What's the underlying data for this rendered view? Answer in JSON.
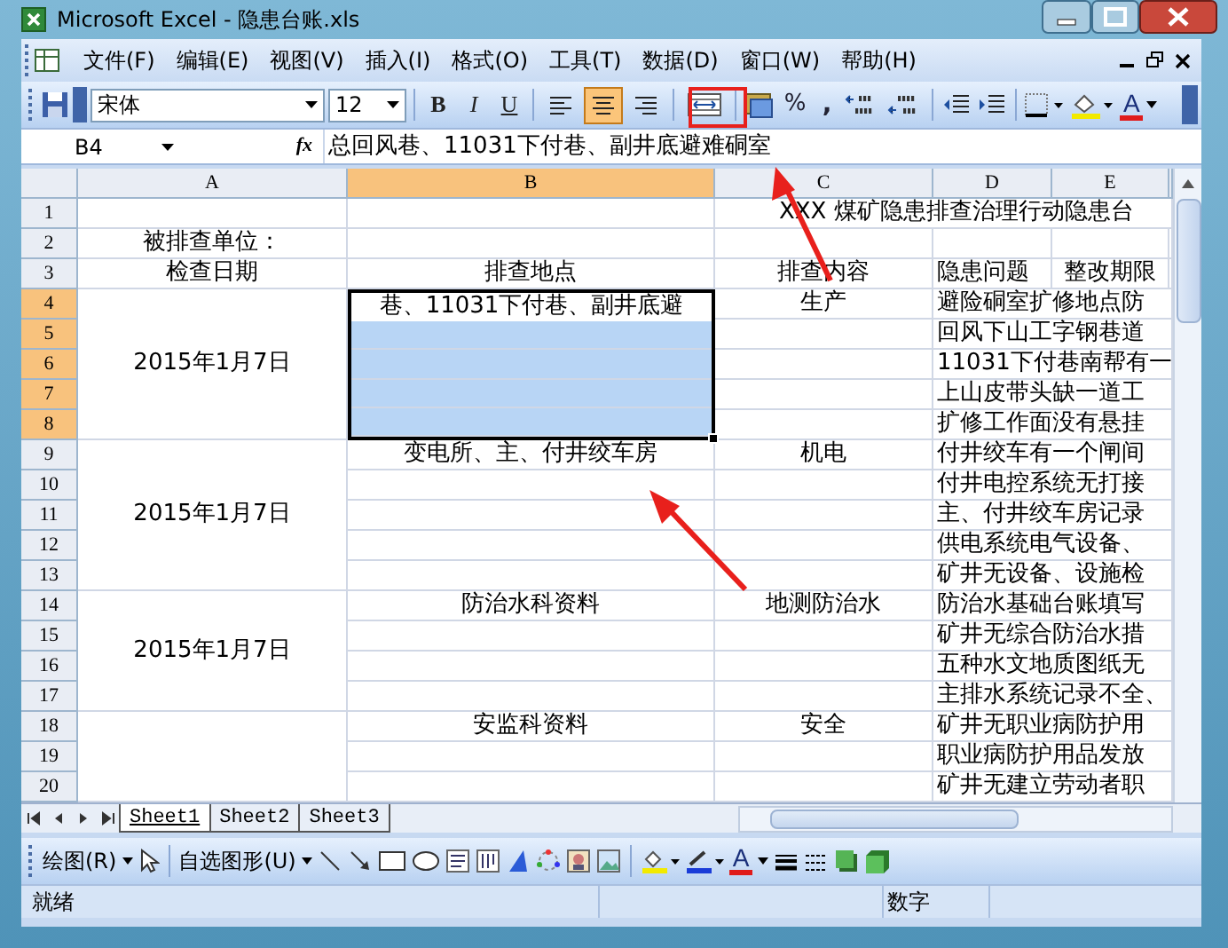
{
  "window": {
    "title": "Microsoft Excel - 隐患台账.xls"
  },
  "menu_bar": {
    "items": [
      "文件(F)",
      "编辑(E)",
      "视图(V)",
      "插入(I)",
      "格式(O)",
      "工具(T)",
      "数据(D)",
      "窗口(W)",
      "帮助(H)"
    ]
  },
  "formatting_toolbar": {
    "font": "宋体",
    "font_size": "12",
    "style_buttons": [
      "B",
      "I",
      "U"
    ],
    "alignment": [
      {
        "selected": false
      },
      {
        "selected": true
      },
      {
        "selected": false
      }
    ],
    "percent": "%",
    "comma": ",",
    "font_color_label": "A"
  },
  "formula_bar": {
    "name_box": "B4",
    "function_label": "fx",
    "value": "总回风巷、11031下付巷、副井底避难硐室"
  },
  "sheet": {
    "columns": [
      {
        "label": "A",
        "selected": false
      },
      {
        "label": "B",
        "selected": true
      },
      {
        "label": "C",
        "selected": false
      },
      {
        "label": "D",
        "selected": false
      },
      {
        "label": "E",
        "selected": false
      }
    ],
    "rows": [
      {
        "label": "1",
        "selected": false,
        "cells": {
          "C": "XXX 煤矿隐患排查治理行动隐患台"
        }
      },
      {
        "label": "2",
        "selected": false,
        "cells": {
          "A": "被排查单位："
        }
      },
      {
        "label": "3",
        "selected": false,
        "cells": {
          "A": "检查日期",
          "B": "排查地点",
          "C": "排查内容",
          "D": "隐患问题",
          "E": "整改期限"
        }
      },
      {
        "label": "4",
        "selected": true,
        "cells": {
          "A": "2015年1月7日",
          "B": "巷、11031下付巷、副井底避",
          "C": "生产",
          "D": "避险硐室扩修地点防"
        }
      },
      {
        "label": "5",
        "selected": true,
        "merge_A_with_above": true,
        "cells": {
          "D": "回风下山工字钢巷道"
        }
      },
      {
        "label": "6",
        "selected": true,
        "merge_A_with_above": true,
        "cells": {
          "D": "11031下付巷南帮有一"
        }
      },
      {
        "label": "7",
        "selected": true,
        "merge_A_with_above": true,
        "cells": {
          "D": "上山皮带头缺一道工"
        }
      },
      {
        "label": "8",
        "selected": true,
        "merge_A_with_above": true,
        "cells": {
          "D": "扩修工作面没有悬挂"
        }
      },
      {
        "label": "9",
        "selected": false,
        "cells": {
          "A": "2015年1月7日",
          "B": "变电所、主、付井绞车房",
          "C": "机电",
          "D": "付井绞车有一个闸间"
        }
      },
      {
        "label": "10",
        "selected": false,
        "merge_A_with_above": true,
        "cells": {
          "D": "付井电控系统无打接"
        }
      },
      {
        "label": "11",
        "selected": false,
        "merge_A_with_above": true,
        "cells": {
          "D": "主、付井绞车房记录"
        }
      },
      {
        "label": "12",
        "selected": false,
        "merge_A_with_above": true,
        "cells": {
          "D": "供电系统电气设备、"
        }
      },
      {
        "label": "13",
        "selected": false,
        "merge_A_with_above": true,
        "cells": {
          "D": "矿井无设备、设施检"
        }
      },
      {
        "label": "14",
        "selected": false,
        "cells": {
          "A": "2015年1月7日",
          "B": "防治水科资料",
          "C": "地测防治水",
          "D": "防治水基础台账填写"
        }
      },
      {
        "label": "15",
        "selected": false,
        "merge_A_with_above": true,
        "cells": {
          "D": "矿井无综合防治水措"
        }
      },
      {
        "label": "16",
        "selected": false,
        "merge_A_with_above": true,
        "cells": {
          "D": "五种水文地质图纸无"
        }
      },
      {
        "label": "17",
        "selected": false,
        "merge_A_with_above": true,
        "cells": {
          "D": "主排水系统记录不全、"
        }
      },
      {
        "label": "18",
        "selected": false,
        "cells": {
          "B": "安监科资料",
          "C": "安全",
          "D": "矿井无职业病防护用"
        }
      },
      {
        "label": "19",
        "selected": false,
        "merge_A_with_above": true,
        "cells": {
          "D": "职业病防护用品发放"
        }
      },
      {
        "label": "20",
        "selected": false,
        "merge_A_with_above": true,
        "cells": {
          "D": "矿井无建立劳动者职"
        }
      }
    ]
  },
  "sheet_tabs": [
    {
      "label": "Sheet1",
      "selected": true
    },
    {
      "label": "Sheet2",
      "selected": false
    },
    {
      "label": "Sheet3",
      "selected": false
    }
  ],
  "drawing_toolbar": {
    "draw_menu": "绘图(R)",
    "autoshapes_menu": "自选图形(U)",
    "font_color_label": "A"
  },
  "status_bar": {
    "status": "就绪",
    "mode": "数字"
  }
}
